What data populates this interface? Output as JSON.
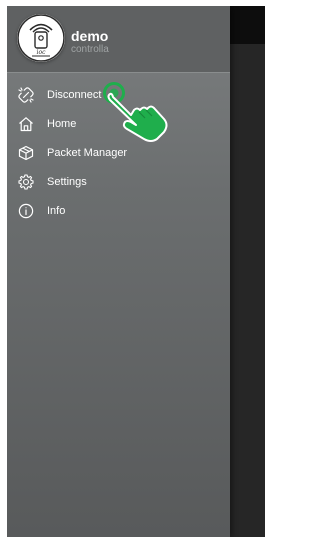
{
  "header": {
    "user_name": "demo",
    "user_subtitle": "controlla",
    "avatar_icon": "device-logo-icon"
  },
  "menu": {
    "items": [
      {
        "label": "Disconnect",
        "icon": "unlink-icon"
      },
      {
        "label": "Home",
        "icon": "home-icon"
      },
      {
        "label": "Packet Manager",
        "icon": "package-icon"
      },
      {
        "label": "Settings",
        "icon": "gear-icon"
      },
      {
        "label": "Info",
        "icon": "info-icon"
      }
    ]
  },
  "overlay": {
    "pointer_icon": "tap-hand-icon",
    "pointer_color": "#1fae4c"
  },
  "colors": {
    "drawer_top": "#7c7f80",
    "drawer_bottom": "#585a5b",
    "backdrop": "#262626",
    "text": "#ffffff",
    "subtitle": "#9fa3a4"
  }
}
